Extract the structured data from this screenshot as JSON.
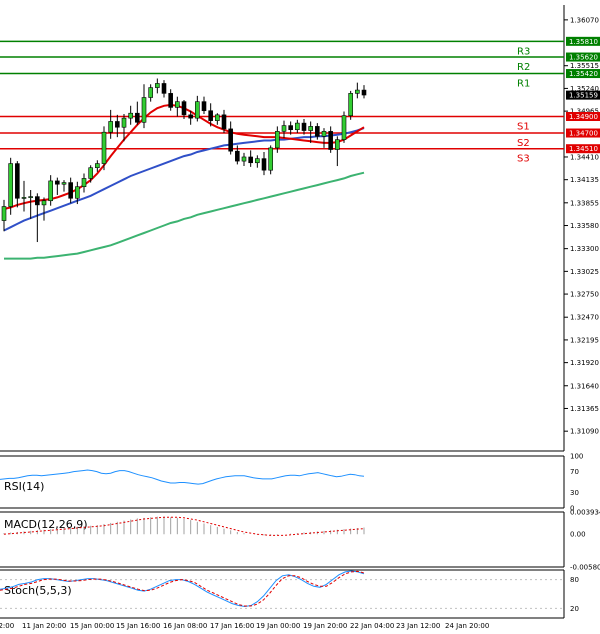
{
  "chart_data": [
    {
      "type": "candlestick",
      "ylim": [
        1.3085,
        1.3625
      ],
      "yticks": [
        "1.36070",
        "1.35515",
        "1.35240",
        "1.34965",
        "1.34410",
        "1.34135",
        "1.33855",
        "1.33580",
        "1.33300",
        "1.33025",
        "1.32750",
        "1.32470",
        "1.32195",
        "1.31920",
        "1.31640",
        "1.31365",
        "1.31090"
      ],
      "x_labels": [
        "12:00",
        "11 Jan 20:00",
        "15 Jan 00:00",
        "15 Jan 16:00",
        "16 Jan 08:00",
        "17 Jan 16:00",
        "19 Jan 00:00",
        "19 Jan 20:00",
        "22 Jan 04:00",
        "23 Jan 12:00",
        "24 Jan 20:00"
      ],
      "current_price": "1.35159",
      "levels": [
        {
          "name": "R3",
          "value": 1.3581,
          "label": "1.35810",
          "color": "#008000"
        },
        {
          "name": "R2",
          "value": 1.3562,
          "label": "1.35620",
          "color": "#008000"
        },
        {
          "name": "R1",
          "value": 1.3542,
          "label": "1.35420",
          "color": "#008000"
        },
        {
          "name": "S1",
          "value": 1.349,
          "label": "1.34900",
          "color": "#e00000"
        },
        {
          "name": "S2",
          "value": 1.347,
          "label": "1.34700",
          "color": "#e00000"
        },
        {
          "name": "S3",
          "value": 1.3451,
          "label": "1.34510",
          "color": "#e00000"
        }
      ],
      "candles": [
        [
          1.3364,
          1.3389,
          1.3351,
          1.3381
        ],
        [
          1.3381,
          1.344,
          1.3371,
          1.3433
        ],
        [
          1.3433,
          1.3436,
          1.338,
          1.3391
        ],
        [
          1.3391,
          1.3412,
          1.3375,
          1.3392
        ],
        [
          1.3392,
          1.3401,
          1.3366,
          1.3393
        ],
        [
          1.3393,
          1.3397,
          1.3338,
          1.3383
        ],
        [
          1.3383,
          1.3392,
          1.3364,
          1.3388
        ],
        [
          1.3388,
          1.3419,
          1.3382,
          1.3412
        ],
        [
          1.3412,
          1.3416,
          1.3395,
          1.3408
        ],
        [
          1.3408,
          1.3413,
          1.3399,
          1.341
        ],
        [
          1.341,
          1.3416,
          1.3385,
          1.3391
        ],
        [
          1.3391,
          1.3411,
          1.3384,
          1.3405
        ],
        [
          1.3405,
          1.3421,
          1.3398,
          1.3415
        ],
        [
          1.3415,
          1.3431,
          1.341,
          1.3428
        ],
        [
          1.3428,
          1.3437,
          1.3423,
          1.3433
        ],
        [
          1.3433,
          1.3478,
          1.3425,
          1.3471
        ],
        [
          1.3471,
          1.3498,
          1.3463,
          1.3484
        ],
        [
          1.3484,
          1.3492,
          1.3465,
          1.3477
        ],
        [
          1.3477,
          1.3493,
          1.346,
          1.3488
        ],
        [
          1.3488,
          1.3503,
          1.348,
          1.3494
        ],
        [
          1.3494,
          1.3508,
          1.348,
          1.3483
        ],
        [
          1.3483,
          1.3529,
          1.3476,
          1.3513
        ],
        [
          1.3513,
          1.3529,
          1.3508,
          1.3525
        ],
        [
          1.3525,
          1.3536,
          1.3518,
          1.353
        ],
        [
          1.353,
          1.3534,
          1.3513,
          1.3518
        ],
        [
          1.3518,
          1.3523,
          1.3497,
          1.3501
        ],
        [
          1.3501,
          1.3514,
          1.349,
          1.3508
        ],
        [
          1.3508,
          1.351,
          1.3487,
          1.3492
        ],
        [
          1.3492,
          1.3497,
          1.348,
          1.3488
        ],
        [
          1.3488,
          1.3515,
          1.3484,
          1.3508
        ],
        [
          1.3508,
          1.3514,
          1.3493,
          1.3497
        ],
        [
          1.3497,
          1.3506,
          1.3478,
          1.3485
        ],
        [
          1.3485,
          1.3494,
          1.348,
          1.3492
        ],
        [
          1.3492,
          1.3498,
          1.347,
          1.3475
        ],
        [
          1.3475,
          1.3484,
          1.3444,
          1.3448
        ],
        [
          1.3448,
          1.3455,
          1.3432,
          1.3436
        ],
        [
          1.3436,
          1.3446,
          1.343,
          1.3441
        ],
        [
          1.3441,
          1.3449,
          1.3429,
          1.3434
        ],
        [
          1.3434,
          1.3443,
          1.3428,
          1.3439
        ],
        [
          1.3439,
          1.3447,
          1.3419,
          1.3425
        ],
        [
          1.3425,
          1.3455,
          1.342,
          1.3452
        ],
        [
          1.3452,
          1.3478,
          1.3446,
          1.3472
        ],
        [
          1.3472,
          1.3485,
          1.3464,
          1.3479
        ],
        [
          1.3479,
          1.3484,
          1.3468,
          1.3474
        ],
        [
          1.3474,
          1.3486,
          1.347,
          1.3482
        ],
        [
          1.3482,
          1.3487,
          1.3468,
          1.3473
        ],
        [
          1.3473,
          1.3484,
          1.3458,
          1.3478
        ],
        [
          1.3478,
          1.3482,
          1.3462,
          1.3466
        ],
        [
          1.3466,
          1.3476,
          1.3452,
          1.3472
        ],
        [
          1.3472,
          1.3478,
          1.3446,
          1.345
        ],
        [
          1.345,
          1.3466,
          1.343,
          1.3462
        ],
        [
          1.3462,
          1.3496,
          1.3458,
          1.3491
        ],
        [
          1.3491,
          1.3521,
          1.3486,
          1.3518
        ],
        [
          1.3518,
          1.3531,
          1.3512,
          1.3522
        ],
        [
          1.3522,
          1.3528,
          1.3512,
          1.3516
        ]
      ],
      "ma_red": [
        1.3378,
        1.338,
        1.3383,
        1.3385,
        1.3387,
        1.3388,
        1.3389,
        1.339,
        1.3392,
        1.3395,
        1.3398,
        1.3402,
        1.3407,
        1.3413,
        1.3421,
        1.3431,
        1.3442,
        1.3452,
        1.3462,
        1.3471,
        1.348,
        1.3488,
        1.3495,
        1.35,
        1.3503,
        1.3504,
        1.3503,
        1.35,
        1.3496,
        1.3491,
        1.3486,
        1.3481,
        1.3477,
        1.3474,
        1.3471,
        1.3469,
        1.3468,
        1.3467,
        1.3466,
        1.3465,
        1.3465,
        1.3465,
        1.3464,
        1.3463,
        1.3462,
        1.3461,
        1.346,
        1.3459,
        1.3458,
        1.3458,
        1.3459,
        1.3462,
        1.3467,
        1.3472,
        1.3477
      ],
      "ma_blue": [
        1.3352,
        1.3356,
        1.336,
        1.3364,
        1.3367,
        1.337,
        1.3373,
        1.3376,
        1.3379,
        1.3382,
        1.3385,
        1.3388,
        1.3391,
        1.3394,
        1.3398,
        1.3402,
        1.3406,
        1.341,
        1.3414,
        1.3418,
        1.3421,
        1.3424,
        1.3427,
        1.343,
        1.3433,
        1.3436,
        1.3439,
        1.3442,
        1.3444,
        1.3447,
        1.3449,
        1.3451,
        1.3453,
        1.3455,
        1.3456,
        1.3457,
        1.3458,
        1.3459,
        1.346,
        1.3461,
        1.3461,
        1.3462,
        1.3462,
        1.3463,
        1.3464,
        1.3465,
        1.3465,
        1.3466,
        1.3466,
        1.3467,
        1.3468,
        1.3469,
        1.3471,
        1.3473,
        1.3476
      ],
      "ma_green": [
        1.3318,
        1.3318,
        1.3318,
        1.3318,
        1.3318,
        1.3319,
        1.3319,
        1.332,
        1.3321,
        1.3322,
        1.3323,
        1.3324,
        1.3326,
        1.3328,
        1.333,
        1.3332,
        1.3334,
        1.3337,
        1.334,
        1.3343,
        1.3346,
        1.3349,
        1.3352,
        1.3355,
        1.3358,
        1.3361,
        1.3363,
        1.3366,
        1.3368,
        1.3371,
        1.3373,
        1.3375,
        1.3377,
        1.3379,
        1.3381,
        1.3383,
        1.3385,
        1.3387,
        1.3389,
        1.3391,
        1.3393,
        1.3395,
        1.3397,
        1.3399,
        1.3401,
        1.3403,
        1.3405,
        1.3407,
        1.3409,
        1.3411,
        1.3413,
        1.3415,
        1.3418,
        1.342,
        1.3422
      ]
    },
    {
      "type": "line",
      "label": "RSI(14)",
      "ylim": [
        0,
        100
      ],
      "yticks": [
        "100",
        "70",
        "30",
        "0"
      ],
      "values": [
        55,
        56,
        57,
        57,
        58,
        60,
        62,
        63,
        63,
        62,
        63,
        64,
        65,
        66,
        67,
        68,
        70,
        71,
        72,
        73,
        72,
        70,
        67,
        66,
        67,
        70,
        72,
        72,
        70,
        67,
        64,
        62,
        60,
        58,
        55,
        52,
        50,
        48,
        48,
        49,
        49,
        48,
        47,
        46,
        47,
        50,
        53,
        56,
        58,
        60,
        61,
        62,
        62,
        62,
        60,
        58,
        57,
        56,
        56,
        56,
        58,
        60,
        62,
        63,
        63,
        62,
        64,
        66,
        67,
        68,
        66,
        64,
        62,
        60,
        61,
        63,
        65,
        64,
        62,
        61
      ]
    },
    {
      "type": "histogram",
      "label": "MACD(12,26,9)",
      "ylim": [
        -0.005803,
        0.003934
      ],
      "yticks": [
        "0.003934",
        "0.00",
        "-0.005803"
      ],
      "values": [
        0.0002,
        0.0003,
        0.0004,
        0.0005,
        0.0006,
        0.0007,
        0.0008,
        0.0009,
        0.001,
        0.0011,
        0.0012,
        0.0013,
        0.0014,
        0.0015,
        0.0016,
        0.0018,
        0.002,
        0.0022,
        0.0024,
        0.0026,
        0.0028,
        0.0029,
        0.003,
        0.0031,
        0.0031,
        0.003,
        0.0029,
        0.0027,
        0.0025,
        0.0022,
        0.0019,
        0.0016,
        0.0013,
        0.001,
        0.0007,
        0.0004,
        0.0002,
        0.0,
        -0.0001,
        -0.0002,
        -0.0002,
        -0.0001,
        0.0,
        0.0001,
        0.0002,
        0.0003,
        0.0004,
        0.0005,
        0.0006,
        0.0007,
        0.0008,
        0.0009,
        0.001,
        0.0011,
        0.0012
      ],
      "signal": [
        0.0,
        0.0001,
        0.0002,
        0.0003,
        0.0004,
        0.0005,
        0.0006,
        0.0007,
        0.0008,
        0.0009,
        0.001,
        0.0011,
        0.0012,
        0.0013,
        0.0014,
        0.0015,
        0.0017,
        0.0019,
        0.0021,
        0.0023,
        0.0025,
        0.0027,
        0.0028,
        0.0029,
        0.003,
        0.003,
        0.003,
        0.0029,
        0.0027,
        0.0025,
        0.0022,
        0.0019,
        0.0016,
        0.0013,
        0.001,
        0.0007,
        0.0004,
        0.0002,
        0.0,
        -0.0001,
        -0.0002,
        -0.0002,
        -0.0002,
        -0.0001,
        0.0,
        0.0001,
        0.0002,
        0.0003,
        0.0004,
        0.0005,
        0.0006,
        0.0007,
        0.0008,
        0.0009,
        0.001
      ]
    },
    {
      "type": "line",
      "label": "Stoch(5,5,3)",
      "ylim": [
        0,
        100
      ],
      "yticks": [
        "80",
        "20"
      ],
      "main": [
        60,
        62,
        65,
        70,
        72,
        75,
        80,
        82,
        82,
        80,
        78,
        76,
        78,
        80,
        82,
        82,
        80,
        78,
        74,
        70,
        66,
        62,
        58,
        56,
        60,
        66,
        72,
        78,
        80,
        80,
        76,
        70,
        62,
        54,
        48,
        42,
        36,
        30,
        26,
        24,
        26,
        34,
        46,
        62,
        78,
        88,
        90,
        86,
        80,
        72,
        66,
        64,
        70,
        80,
        90,
        96,
        98,
        96,
        92
      ],
      "signal": [
        58,
        60,
        62,
        66,
        70,
        72,
        76,
        80,
        81,
        81,
        79,
        77,
        77,
        78,
        80,
        81,
        81,
        79,
        76,
        72,
        68,
        64,
        60,
        57,
        58,
        62,
        68,
        74,
        78,
        80,
        78,
        74,
        66,
        58,
        52,
        46,
        40,
        34,
        28,
        25,
        25,
        29,
        38,
        52,
        68,
        82,
        88,
        88,
        84,
        76,
        70,
        66,
        66,
        74,
        84,
        92,
        96,
        97,
        94
      ]
    }
  ]
}
